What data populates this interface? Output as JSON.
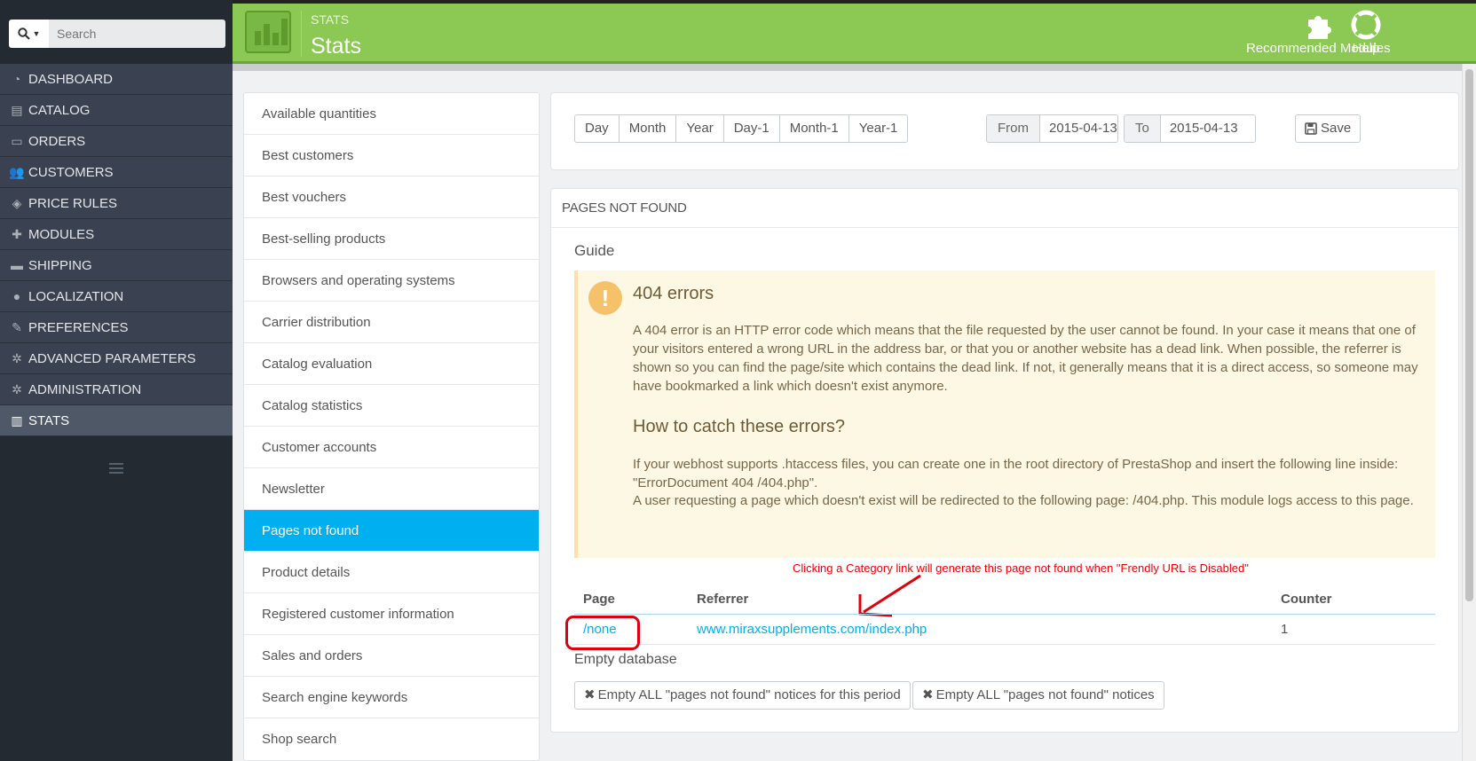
{
  "search": {
    "placeholder": "Search"
  },
  "sidebar": {
    "items": [
      {
        "label": "DASHBOARD",
        "icon": "dashboard-icon"
      },
      {
        "label": "CATALOG",
        "icon": "book-icon"
      },
      {
        "label": "ORDERS",
        "icon": "credit-card-icon"
      },
      {
        "label": "CUSTOMERS",
        "icon": "users-icon"
      },
      {
        "label": "PRICE RULES",
        "icon": "tags-icon"
      },
      {
        "label": "MODULES",
        "icon": "puzzle-icon"
      },
      {
        "label": "SHIPPING",
        "icon": "truck-icon"
      },
      {
        "label": "LOCALIZATION",
        "icon": "globe-icon"
      },
      {
        "label": "PREFERENCES",
        "icon": "wrench-icon"
      },
      {
        "label": "ADVANCED PARAMETERS",
        "icon": "cogs-icon"
      },
      {
        "label": "ADMINISTRATION",
        "icon": "cog-icon"
      },
      {
        "label": "STATS",
        "icon": "bar-chart-icon"
      }
    ],
    "active": "STATS"
  },
  "header": {
    "breadcrumb": "STATS",
    "title": "Stats",
    "recommended_label": "Recommended Modules",
    "help_label": "Help"
  },
  "modules": [
    "Available quantities",
    "Best customers",
    "Best vouchers",
    "Best-selling products",
    "Browsers and operating systems",
    "Carrier distribution",
    "Catalog evaluation",
    "Catalog statistics",
    "Customer accounts",
    "Newsletter",
    "Pages not found",
    "Product details",
    "Registered customer information",
    "Sales and orders",
    "Search engine keywords",
    "Shop search"
  ],
  "active_module": "Pages not found",
  "date_filter": {
    "presets": [
      "Day",
      "Month",
      "Year",
      "Day-1",
      "Month-1",
      "Year-1"
    ],
    "from_label": "From",
    "from_value": "2015-04-13",
    "to_label": "To",
    "to_value": "2015-04-13",
    "save_label": "Save"
  },
  "panel": {
    "heading": "PAGES NOT FOUND",
    "guide_title": "Guide",
    "alert_title": "404 errors",
    "alert_text": "A 404 error is an HTTP error code which means that the file requested by the user cannot be found. In your case it means that one of your visitors entered a wrong URL in the address bar, or that you or another website has a dead link. When possible, the referrer is shown so you can find the page/site which contains the dead link. If not, it generally means that it is a direct access, so someone may have bookmarked a link which doesn't exist anymore.",
    "catch_title": "How to catch these errors?",
    "catch_text_1": "If your webhost supports .htaccess files, you can create one in the root directory of PrestaShop and insert the following line inside: \"ErrorDocument 404 /404.php\".",
    "catch_text_2": "A user requesting a page which doesn't exist will be redirected to the following page: /404.php. This module logs access to this page.",
    "annotation": "Clicking a Category link will generate this page not found when \"Frendly URL is Disabled\"",
    "table": {
      "headers": [
        "Page",
        "Referrer",
        "Counter"
      ],
      "rows": [
        {
          "page": "/none",
          "referrer": "www.miraxsupplements.com/index.php",
          "counter": "1"
        }
      ]
    },
    "empty_title": "Empty database",
    "empty_period_label": "Empty ALL \"pages not found\" notices for this period",
    "empty_all_label": "Empty ALL \"pages not found\" notices"
  },
  "colors": {
    "header_green": "#8bc954",
    "sidebar_dark": "#232a32",
    "accent_blue": "#00aff0",
    "annotation_red": "#e0000b"
  }
}
